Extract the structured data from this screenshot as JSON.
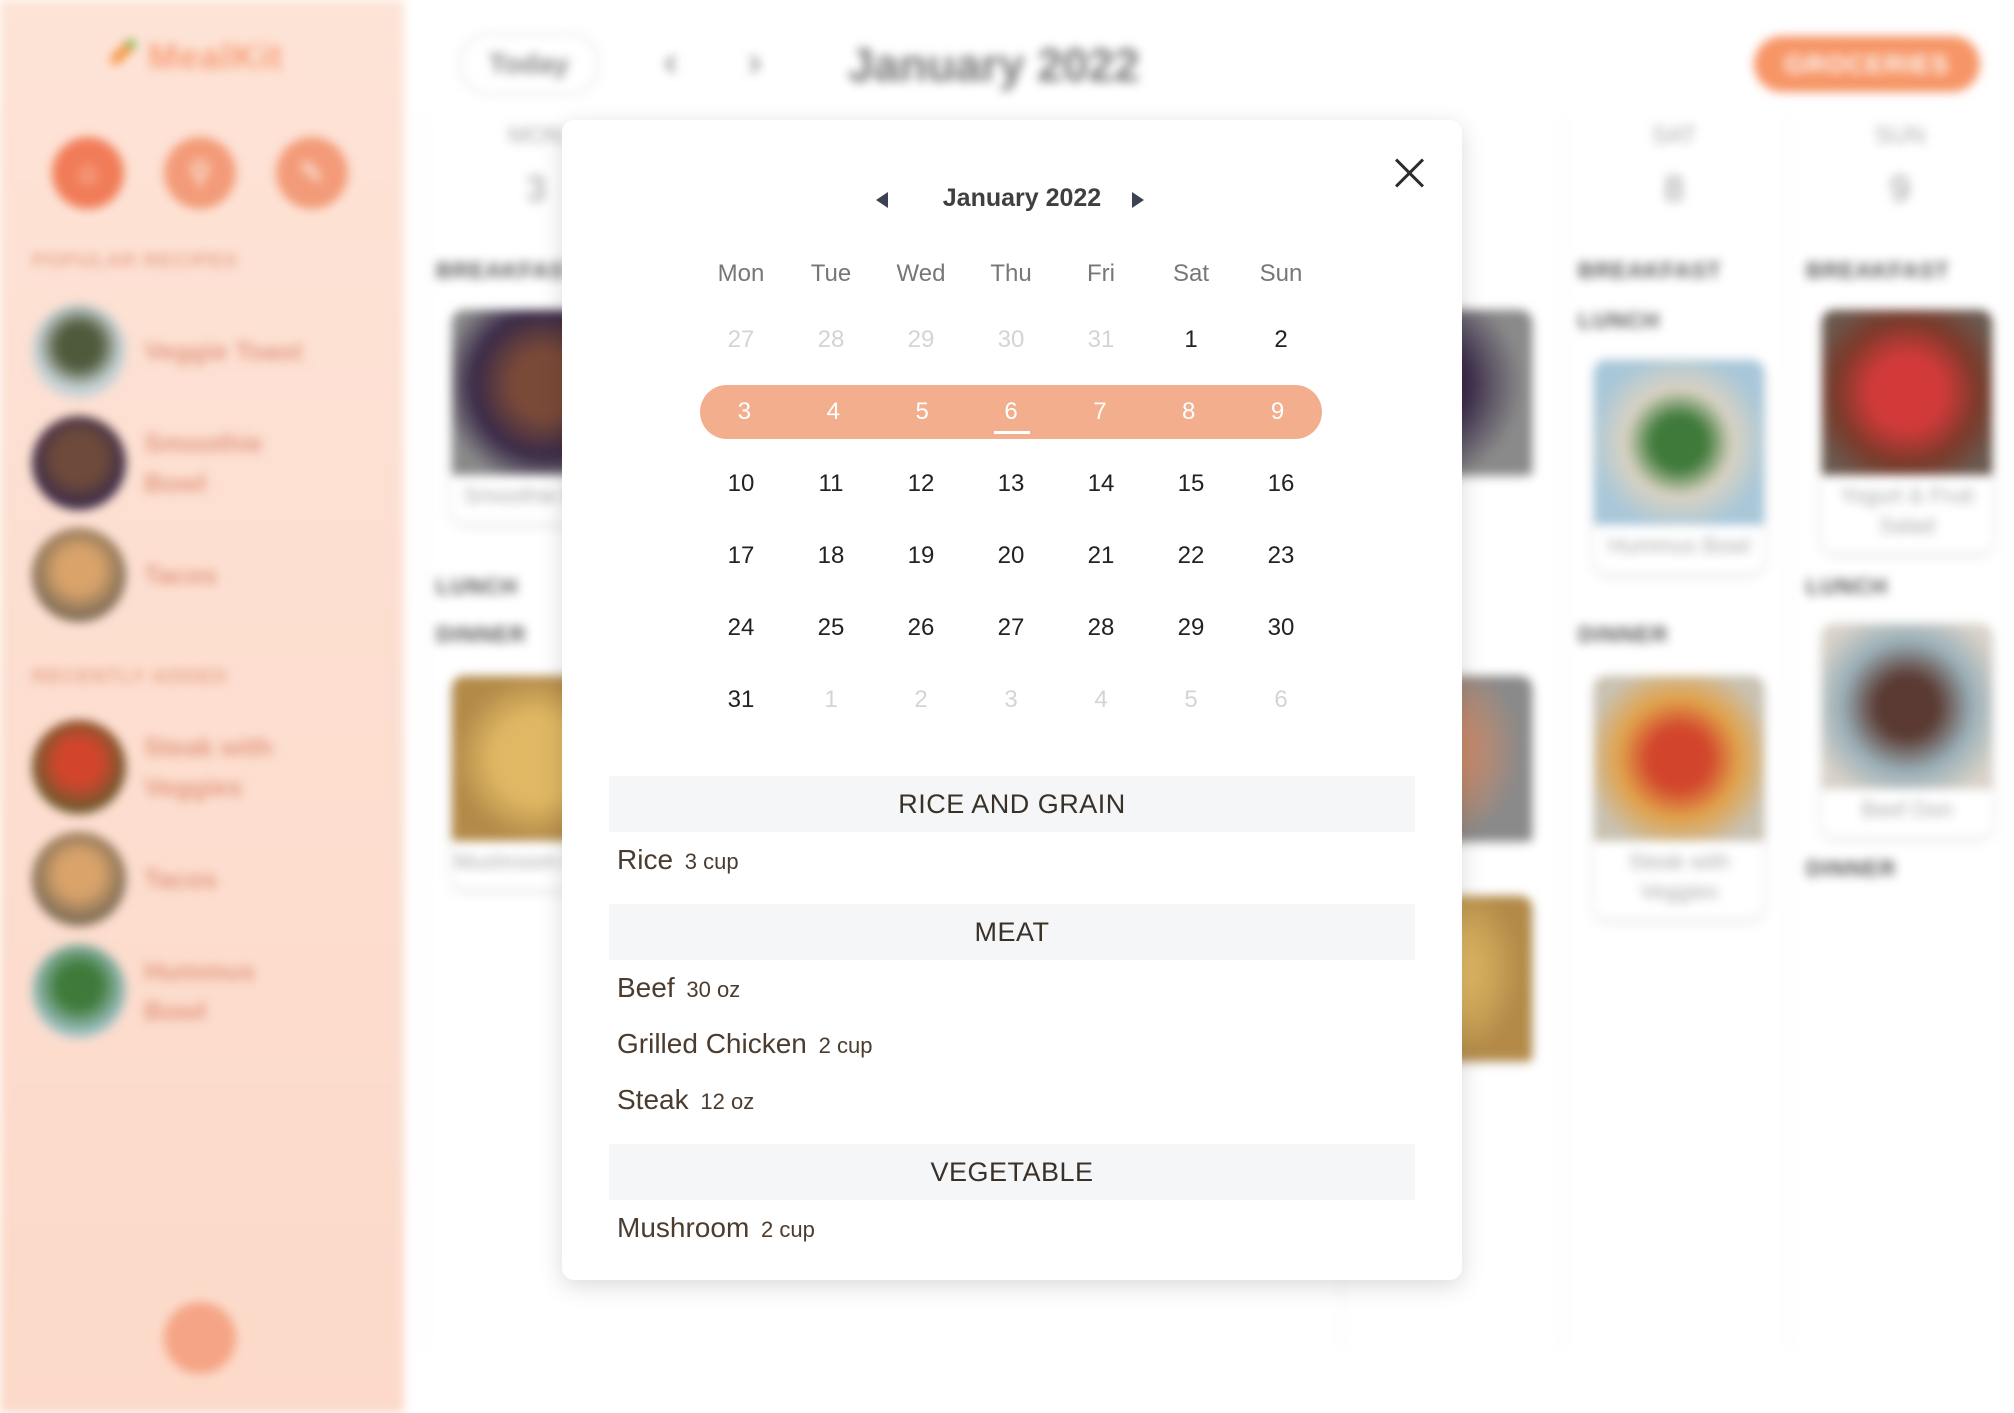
{
  "app": {
    "logo_text": "MealKit",
    "sidebar": {
      "popular_heading": "POPULAR RECIPES",
      "popular": [
        "Veggie Toast",
        "Smoothie Bowl",
        "Tacos"
      ],
      "recent_heading": "RECENTLY ADDED",
      "recent": [
        "Steak with Veggies",
        "Tacos",
        "Hummus Bowl"
      ]
    },
    "topbar": {
      "today_label": "Today",
      "prev_glyph": "‹",
      "next_glyph": "›",
      "month_label": "January 2022",
      "groceries_label": "GROCERIES"
    },
    "days": [
      {
        "name": "MON",
        "num": "3"
      },
      {
        "name": "SAT",
        "num": "8"
      },
      {
        "name": "SUN",
        "num": "9"
      }
    ],
    "meals": {
      "breakfast": "BREAKFAST",
      "lunch": "LUNCH",
      "dinner": "DINNER",
      "mon_breakfast": "Smoothie Bowl",
      "mon_dinner": "Mushroom Pasta",
      "sat_lunch": "Hummus Bowl",
      "sat_dinner": "Steak with Veggies",
      "sun_breakfast": "Yogurt & Fruit Salad",
      "sun_lunch": "Beef Don"
    }
  },
  "modal": {
    "calendar": {
      "title": "January 2022",
      "weekdays": [
        "Mon",
        "Tue",
        "Wed",
        "Thu",
        "Fri",
        "Sat",
        "Sun"
      ],
      "weeks": [
        [
          "27",
          "28",
          "29",
          "30",
          "31",
          "1",
          "2"
        ],
        [
          "3",
          "4",
          "5",
          "6",
          "7",
          "8",
          "9"
        ],
        [
          "10",
          "11",
          "12",
          "13",
          "14",
          "15",
          "16"
        ],
        [
          "17",
          "18",
          "19",
          "20",
          "21",
          "22",
          "23"
        ],
        [
          "24",
          "25",
          "26",
          "27",
          "28",
          "29",
          "30"
        ],
        [
          "31",
          "1",
          "2",
          "3",
          "4",
          "5",
          "6"
        ]
      ],
      "selected_week_color": "#f3ae8e",
      "today": "6"
    },
    "groceries": [
      {
        "category": "RICE AND GRAIN",
        "items": [
          {
            "name": "Rice",
            "qty": "3 cup"
          }
        ]
      },
      {
        "category": "MEAT",
        "items": [
          {
            "name": "Beef",
            "qty": "30 oz"
          },
          {
            "name": "Grilled Chicken",
            "qty": "2 cup"
          },
          {
            "name": "Steak",
            "qty": "12 oz"
          }
        ]
      },
      {
        "category": "VEGETABLE",
        "items": [
          {
            "name": "Mushroom",
            "qty": "2 cup"
          }
        ]
      }
    ]
  },
  "colors": {
    "accent": "#f79566",
    "sidebar_bg": "#fde3d6",
    "text_brown": "#4b3c2f"
  }
}
